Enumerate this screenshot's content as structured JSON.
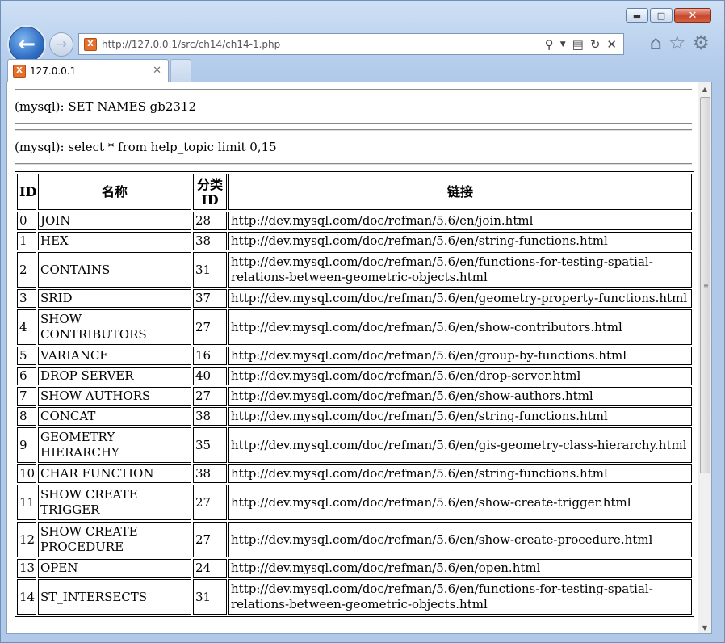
{
  "browser": {
    "address": "http://127.0.0.1/src/ch14/ch14-1.php",
    "tab_title": "127.0.0.1",
    "favicon_letter": "X",
    "icons": {
      "back": "back-arrow-icon",
      "forward": "forward-arrow-icon",
      "search": "search-icon",
      "dropdown": "chevron-down-icon",
      "compat": "compatibility-icon",
      "refresh": "refresh-icon",
      "stop": "close-icon",
      "home": "home-icon",
      "favorites": "star-icon",
      "tools": "gear-icon"
    }
  },
  "page": {
    "sql1": "(mysql): SET NAMES gb2312",
    "sql2": "(mysql): select * from help_topic limit 0,15",
    "table": {
      "headers": [
        "ID",
        "名称",
        "分类ID",
        "链接"
      ],
      "rows": [
        {
          "id": "0",
          "name": "JOIN",
          "cat": "28",
          "url": "http://dev.mysql.com/doc/refman/5.6/en/join.html"
        },
        {
          "id": "1",
          "name": "HEX",
          "cat": "38",
          "url": "http://dev.mysql.com/doc/refman/5.6/en/string-functions.html"
        },
        {
          "id": "2",
          "name": "CONTAINS",
          "cat": "31",
          "url": "http://dev.mysql.com/doc/refman/5.6/en/functions-for-testing-spatial-relations-between-geometric-objects.html"
        },
        {
          "id": "3",
          "name": "SRID",
          "cat": "37",
          "url": "http://dev.mysql.com/doc/refman/5.6/en/geometry-property-functions.html"
        },
        {
          "id": "4",
          "name": "SHOW CONTRIBUTORS",
          "cat": "27",
          "url": "http://dev.mysql.com/doc/refman/5.6/en/show-contributors.html"
        },
        {
          "id": "5",
          "name": "VARIANCE",
          "cat": "16",
          "url": "http://dev.mysql.com/doc/refman/5.6/en/group-by-functions.html"
        },
        {
          "id": "6",
          "name": "DROP SERVER",
          "cat": "40",
          "url": "http://dev.mysql.com/doc/refman/5.6/en/drop-server.html"
        },
        {
          "id": "7",
          "name": "SHOW AUTHORS",
          "cat": "27",
          "url": "http://dev.mysql.com/doc/refman/5.6/en/show-authors.html"
        },
        {
          "id": "8",
          "name": "CONCAT",
          "cat": "38",
          "url": "http://dev.mysql.com/doc/refman/5.6/en/string-functions.html"
        },
        {
          "id": "9",
          "name": "GEOMETRY HIERARCHY",
          "cat": "35",
          "url": "http://dev.mysql.com/doc/refman/5.6/en/gis-geometry-class-hierarchy.html"
        },
        {
          "id": "10",
          "name": "CHAR FUNCTION",
          "cat": "38",
          "url": "http://dev.mysql.com/doc/refman/5.6/en/string-functions.html"
        },
        {
          "id": "11",
          "name": "SHOW CREATE TRIGGER",
          "cat": "27",
          "url": "http://dev.mysql.com/doc/refman/5.6/en/show-create-trigger.html"
        },
        {
          "id": "12",
          "name": "SHOW CREATE PROCEDURE",
          "cat": "27",
          "url": "http://dev.mysql.com/doc/refman/5.6/en/show-create-procedure.html"
        },
        {
          "id": "13",
          "name": "OPEN",
          "cat": "24",
          "url": "http://dev.mysql.com/doc/refman/5.6/en/open.html"
        },
        {
          "id": "14",
          "name": "ST_INTERSECTS",
          "cat": "31",
          "url": "http://dev.mysql.com/doc/refman/5.6/en/functions-for-testing-spatial-relations-between-geometric-objects.html"
        }
      ]
    }
  }
}
